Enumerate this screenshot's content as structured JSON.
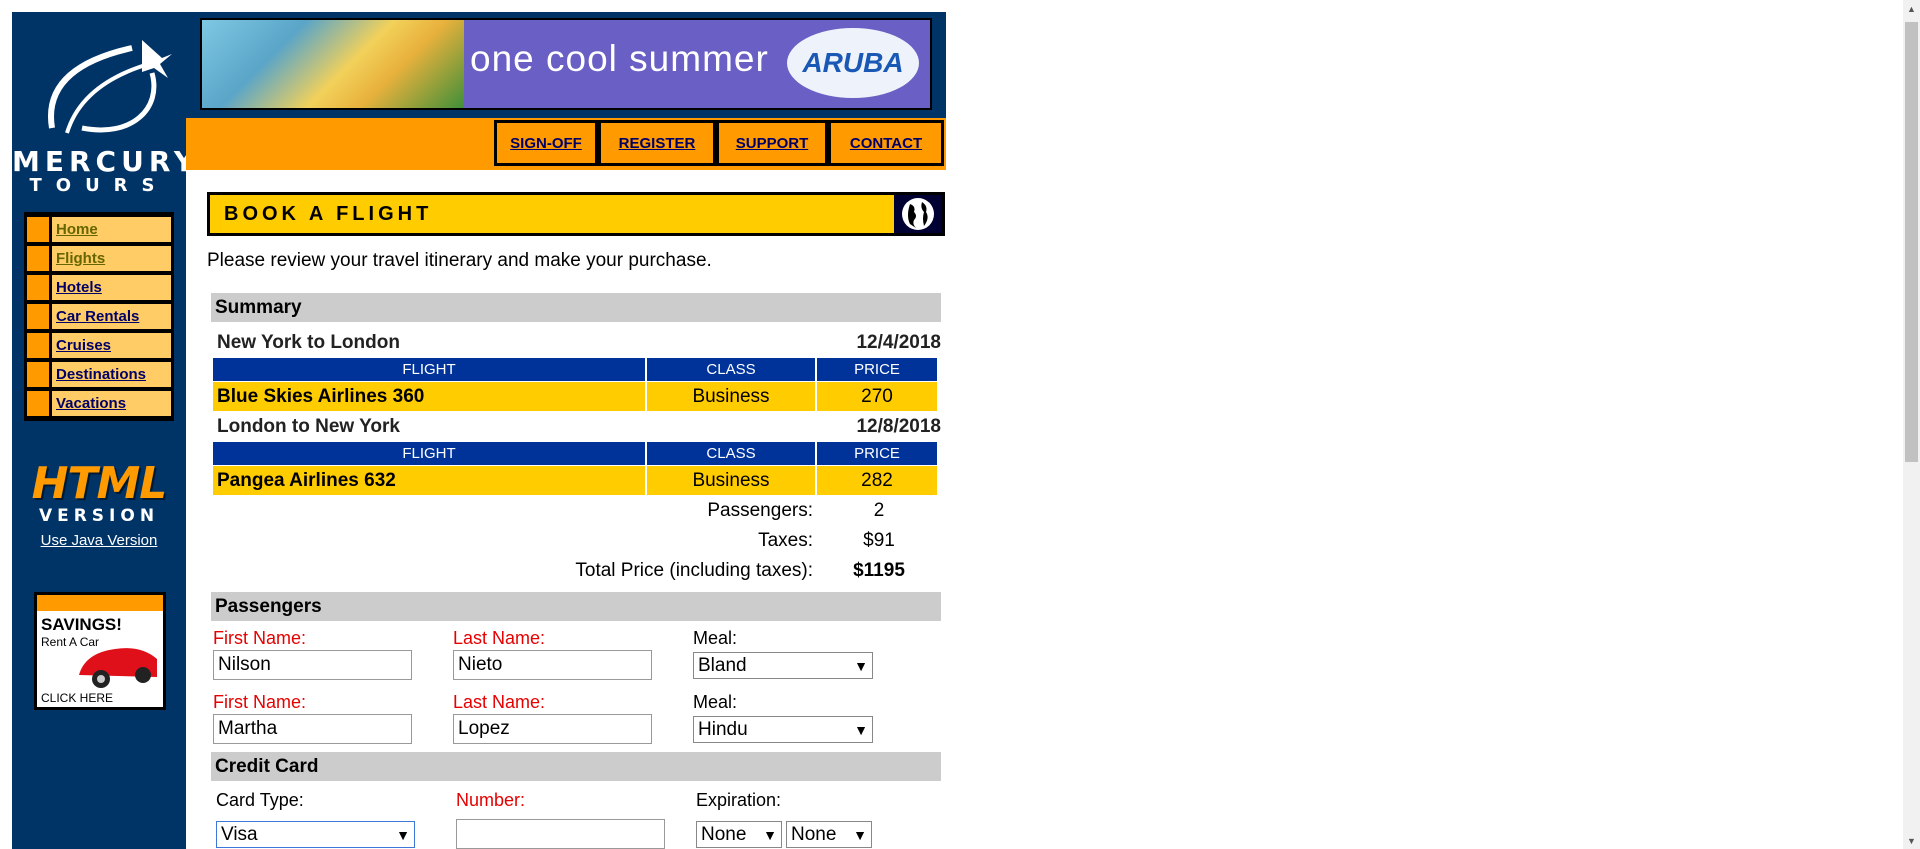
{
  "brand": {
    "name": "MERCURY",
    "sub": "TOURS"
  },
  "nav": [
    {
      "label": "Home",
      "visited": true
    },
    {
      "label": "Flights",
      "visited": true
    },
    {
      "label": "Hotels",
      "visited": false
    },
    {
      "label": "Car Rentals",
      "visited": false
    },
    {
      "label": "Cruises",
      "visited": false
    },
    {
      "label": "Destinations",
      "visited": false
    },
    {
      "label": "Vacations",
      "visited": false
    }
  ],
  "html_version": {
    "big": "HTML",
    "sub": "VERSION",
    "java_link": "Use Java Version"
  },
  "savings_ad": {
    "title": "SAVINGS!",
    "subtitle": "Rent A Car",
    "cta": "CLICK HERE"
  },
  "banner": {
    "tagline": "one cool summer",
    "logo": "ARUBA"
  },
  "top_links": {
    "signoff": "SIGN-OFF",
    "register": "REGISTER",
    "support": "SUPPORT",
    "contact": "CONTACT"
  },
  "page": {
    "title": "BOOK A FLIGHT",
    "intro": "Please review your travel itinerary and make your purchase."
  },
  "summary": {
    "heading": "Summary",
    "col_flight": "FLIGHT",
    "col_class": "CLASS",
    "col_price": "PRICE",
    "depart": {
      "route": "New York to London",
      "date": "12/4/2018",
      "flight": "Blue Skies Airlines 360",
      "class": "Business",
      "price": "270"
    },
    "return": {
      "route": "London to New York",
      "date": "12/8/2018",
      "flight": "Pangea Airlines 632",
      "class": "Business",
      "price": "282"
    },
    "passengers_label": "Passengers:",
    "passengers": "2",
    "taxes_label": "Taxes:",
    "taxes": "$91",
    "total_label": "Total Price (including taxes):",
    "total": "$1195"
  },
  "passengers": {
    "heading": "Passengers",
    "first_label": "First Name:",
    "last_label": "Last Name:",
    "meal_label": "Meal:",
    "p1": {
      "first": "Nilson",
      "last": "Nieto",
      "meal": "Bland"
    },
    "p2": {
      "first": "Martha",
      "last": "Lopez",
      "meal": "Hindu"
    }
  },
  "credit_card": {
    "heading": "Credit Card",
    "type_label": "Card Type:",
    "number_label": "Number:",
    "exp_label": "Expiration:",
    "type": "Visa",
    "number": "",
    "exp_month": "None",
    "exp_year": "None"
  },
  "colors": {
    "sidebar": "#003366",
    "accent": "#ff9a00",
    "header_yellow": "#ffcc00",
    "table_head": "#003399",
    "required": "#e60000"
  }
}
